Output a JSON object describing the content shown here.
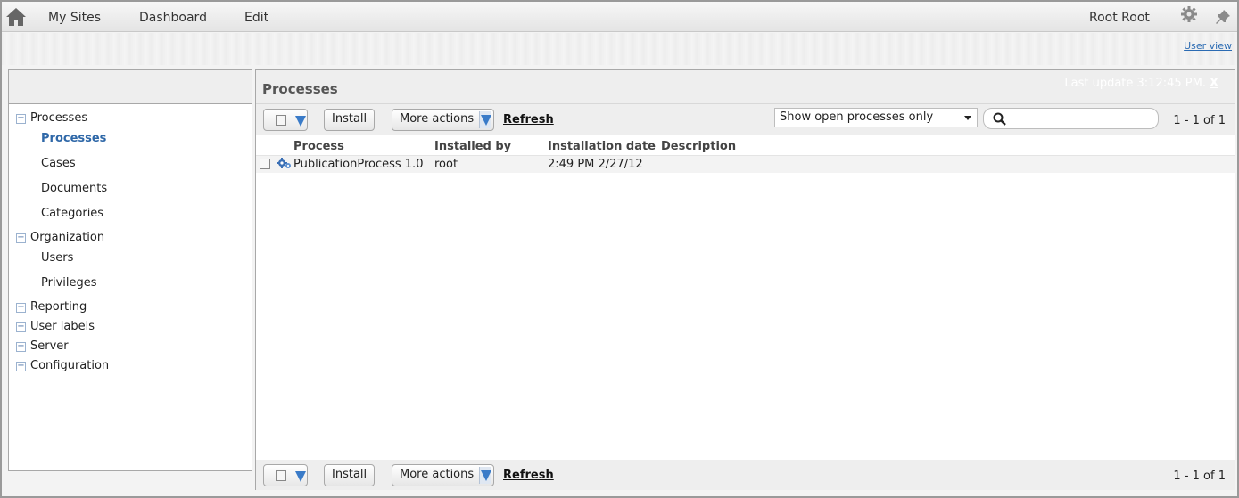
{
  "nav": {
    "items": [
      "My Sites",
      "Dashboard",
      "Edit"
    ],
    "user": "Root Root",
    "user_view": "User view"
  },
  "sidebar": {
    "groups": [
      {
        "label": "Processes",
        "expanded": true,
        "items": [
          "Processes",
          "Cases",
          "Documents",
          "Categories"
        ],
        "active": "Processes"
      },
      {
        "label": "Organization",
        "expanded": true,
        "items": [
          "Users",
          "Privileges"
        ]
      },
      {
        "label": "Reporting",
        "expanded": false
      },
      {
        "label": "User labels",
        "expanded": false
      },
      {
        "label": "Server",
        "expanded": false
      },
      {
        "label": "Configuration",
        "expanded": false
      }
    ]
  },
  "main": {
    "title": "Processes",
    "last_update": "Last update 3:12:45 PM.",
    "close": "X",
    "toolbar": {
      "install": "Install",
      "more_actions": "More actions",
      "refresh": "Refresh",
      "filter": "Show open processes only",
      "pager": "1 - 1 of 1"
    },
    "columns": [
      "Process",
      "Installed by",
      "Installation date",
      "Description"
    ],
    "rows": [
      {
        "process": "PublicationProcess 1.0",
        "installed_by": "root",
        "installation_date": "2:49 PM 2/27/12",
        "description": ""
      }
    ]
  },
  "colors": {
    "accent": "#3a7bc8",
    "active_link": "#2f68a8"
  },
  "icons": [
    "home-icon",
    "gear-icon",
    "pin-icon",
    "search-icon",
    "process-gear-icon",
    "chevron-down-icon"
  ]
}
